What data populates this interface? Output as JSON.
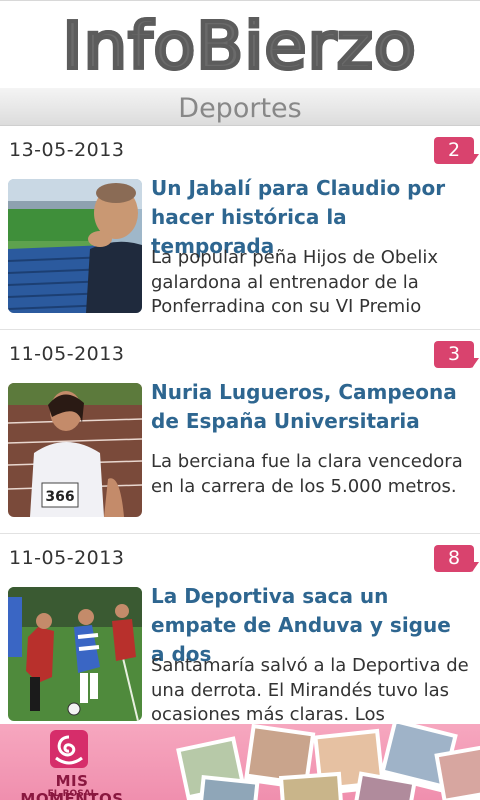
{
  "header": {
    "logo_text": "InfoBierzo"
  },
  "section": {
    "title": "Deportes"
  },
  "articles": [
    {
      "date": "13-05-2013",
      "comments": "2",
      "title": "Un Jabalí para Claudio por hacer histórica la temporada",
      "summary": "La popular peña Hijos de Obelix galardona al entrenador de la Ponferradina con su VI Premio"
    },
    {
      "date": "11-05-2013",
      "comments": "3",
      "title": "Nuria Lugueros, Campeona de España Universitaria",
      "summary": "La berciana fue la clara vencedora en la carrera de los 5.000 metros."
    },
    {
      "date": "11-05-2013",
      "comments": "8",
      "title": "La Deportiva saca un empate de Anduva y sigue a dos",
      "summary": "Santamaría salvó a la Deportiva de una derrota. El Mirandés tuvo las ocasiones más claras. Los"
    }
  ],
  "ad": {
    "brand": "MIS MOMENTOS",
    "sub": "EL ROSAL"
  },
  "thumb_texts": {
    "bib_number": "366"
  },
  "colors": {
    "title_blue": "#2e6690",
    "badge_pink": "#d9436e",
    "ad_pink": "#f08fae"
  }
}
